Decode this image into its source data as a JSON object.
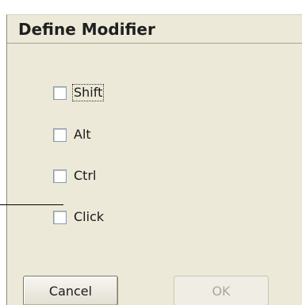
{
  "dialog": {
    "title": "Define Modifier"
  },
  "checkboxes": [
    {
      "label": "Shift",
      "checked": false,
      "focused": true
    },
    {
      "label": "Alt",
      "checked": false,
      "focused": false
    },
    {
      "label": "Ctrl",
      "checked": false,
      "focused": false
    },
    {
      "label": "Click",
      "checked": false,
      "focused": false
    }
  ],
  "buttons": {
    "cancel_label": "Cancel",
    "ok_label": "OK",
    "ok_enabled": false
  }
}
